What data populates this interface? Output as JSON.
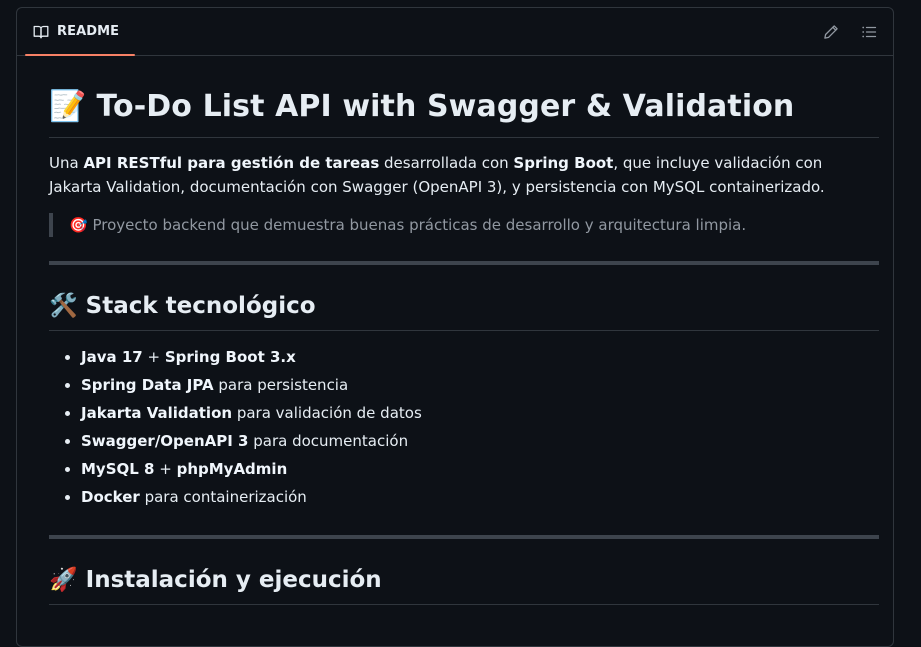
{
  "header": {
    "tab_label": "README",
    "tab_icon": "book-icon",
    "edit_icon": "pencil-icon",
    "outline_icon": "list-unordered-icon",
    "accent_color": "#f78166"
  },
  "readme": {
    "title": {
      "emoji": "📝",
      "text": "To-Do List API with Swagger & Validation"
    },
    "intro": {
      "t1": "Una ",
      "b1": "API RESTful para gestión de tareas",
      "t2": " desarrollada con ",
      "b2": "Spring Boot",
      "t3": ", que incluye validación con Jakarta Validation, documentación con Swagger (OpenAPI 3), y persistencia con MySQL containerizado."
    },
    "quote": {
      "emoji": "🎯",
      "text": "Proyecto backend que demuestra buenas prácticas de desarrollo y arquitectura limpia."
    },
    "stack_heading": {
      "emoji": "🛠️",
      "text": "Stack tecnológico"
    },
    "stack_items": [
      {
        "b1": "Java 17",
        "t1": " + ",
        "b2": "Spring Boot 3.x",
        "t2": ""
      },
      {
        "b1": "Spring Data JPA",
        "t1": " para persistencia",
        "b2": "",
        "t2": ""
      },
      {
        "b1": "Jakarta Validation",
        "t1": " para validación de datos",
        "b2": "",
        "t2": ""
      },
      {
        "b1": "Swagger/OpenAPI 3",
        "t1": " para documentación",
        "b2": "",
        "t2": ""
      },
      {
        "b1": "MySQL 8",
        "t1": " + ",
        "b2": "phpMyAdmin",
        "t2": ""
      },
      {
        "b1": "Docker",
        "t1": " para containerización",
        "b2": "",
        "t2": ""
      }
    ],
    "install_heading": {
      "emoji": "🚀",
      "text": "Instalación y ejecución"
    }
  }
}
